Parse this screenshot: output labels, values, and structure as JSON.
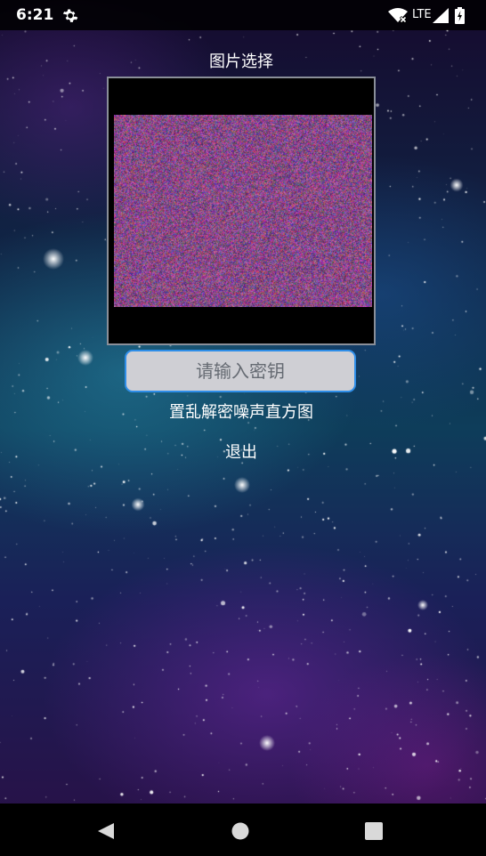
{
  "status_bar": {
    "time": "6:21",
    "network_label": "LTE",
    "icons": [
      "gear-icon",
      "wifi-icon",
      "signal-icon",
      "battery-icon"
    ]
  },
  "main": {
    "title": "图片选择",
    "image_description": "scrambled noise image",
    "key_input": {
      "placeholder": "请输入密钥",
      "value": ""
    },
    "action_button_label": "置乱解密噪声直方图",
    "exit_button_label": "退出"
  },
  "nav_bar": {
    "icons": [
      "back-icon",
      "home-icon",
      "recents-icon"
    ]
  },
  "colors": {
    "accent": "#2f8ee8",
    "input_bg": "#cfcfd4",
    "noise_base": "#7a4f86",
    "frame_border": "#8a8f99"
  }
}
